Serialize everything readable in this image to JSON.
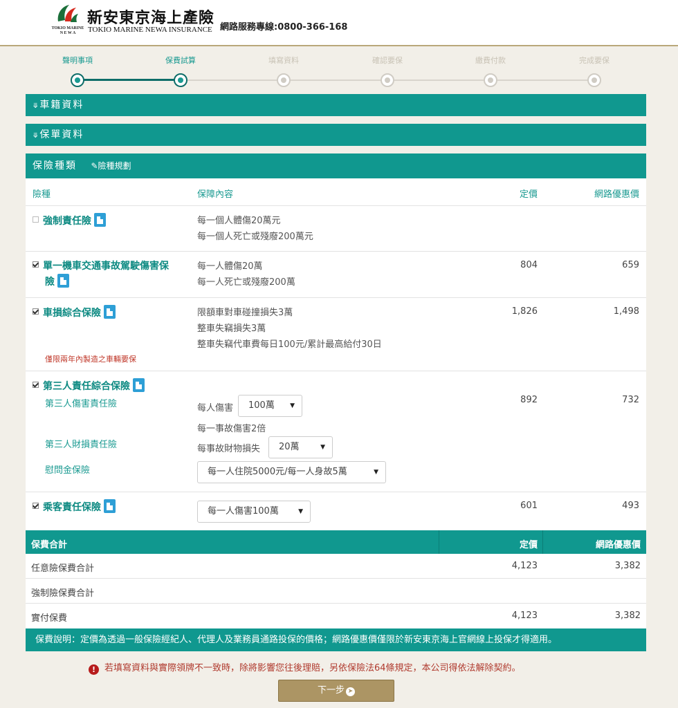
{
  "header": {
    "logo_lines": [
      "TOKIO MARINE",
      "N E W A"
    ],
    "brand_cn": "新安東京海上產險",
    "brand_en": "TOKIO MARINE NEWA INSURANCE",
    "hotline": "網路服務專線:0800-366-168"
  },
  "steps": [
    {
      "label": "聲明事項",
      "done": true
    },
    {
      "label": "保費試算",
      "done": true
    },
    {
      "label": "填寫資料",
      "done": false
    },
    {
      "label": "確認要保",
      "done": false
    },
    {
      "label": "繳費付款",
      "done": false
    },
    {
      "label": "完成要保",
      "done": false
    }
  ],
  "sections": {
    "vehicle": "車籍資料",
    "policy": "保單資料",
    "coverage_type": "保險種類",
    "plan_link": "險種規劃"
  },
  "table": {
    "headers": {
      "name": "險種",
      "coverage": "保障內容",
      "price": "定價",
      "net_price": "網路優惠價"
    },
    "rows": [
      {
        "name": "強制責任險",
        "checked": false,
        "coverage": [
          "每一個人體傷20萬元",
          "每一個人死亡或殘廢200萬元"
        ],
        "price": "",
        "net_price": ""
      },
      {
        "name_lines": [
          "單一機車交通事故駕駛傷害保",
          "險"
        ],
        "checked": true,
        "coverage": [
          "每一人體傷20萬",
          "每一人死亡或殘廢200萬"
        ],
        "price": "804",
        "net_price": "659"
      },
      {
        "name": "車損綜合保險",
        "checked": true,
        "coverage": [
          "限額車對車碰撞損失3萬",
          "整車失竊損失3萬",
          "整車失竊代車費每日100元/累計最高給付30日"
        ],
        "note": "僅限兩年內製造之車輛要保",
        "price": "1,826",
        "net_price": "1,498"
      },
      {
        "name": "第三人責任綜合保險",
        "checked": true,
        "sub_items": [
          "第三人傷害責任險",
          "第三人財損責任險",
          "慰問金保險"
        ],
        "injury_label": "每人傷害",
        "injury_value": "100萬",
        "injury_extra": "每一事故傷害2倍",
        "property_label": "每事故財物損失",
        "property_value": "20萬",
        "consolation_value": "每一人住院5000元/每一人身故5萬",
        "price": "892",
        "net_price": "732"
      },
      {
        "name": "乘客責任保險",
        "checked": true,
        "passenger_value": "每一人傷害100萬",
        "price": "601",
        "net_price": "493"
      }
    ]
  },
  "totals": {
    "header": {
      "label": "保費合計",
      "price": "定價",
      "net_price": "網路優惠價"
    },
    "rows": [
      {
        "label": "任意險保費合計",
        "price": "4,123",
        "net_price": "3,382"
      },
      {
        "label": "強制險保費合計",
        "price": "",
        "net_price": ""
      },
      {
        "label": "實付保費",
        "price": "4,123",
        "net_price": "3,382"
      }
    ]
  },
  "explanation": "保費說明：定價為透過一般保險經紀人、代理人及業務員通路投保的價格；網路優惠價僅限於新安東京海上官網線上投保才得適用。",
  "warning": "若填寫資料與實際領牌不一致時，除將影響您往後理賠，另依保險法64條規定，本公司得依法解除契約。",
  "next_button": "下一步",
  "colors": {
    "primary": "#10988f",
    "accent": "#ac9564",
    "warning": "#b03a2e"
  }
}
